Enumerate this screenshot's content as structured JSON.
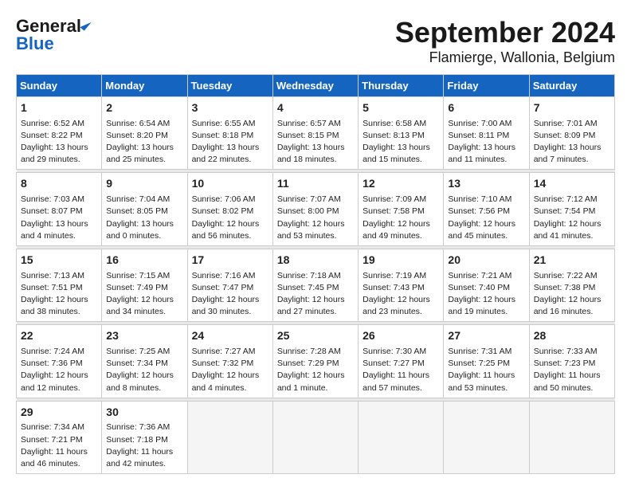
{
  "header": {
    "logo_line1": "General",
    "logo_line2": "Blue",
    "month_title": "September 2024",
    "location": "Flamierge, Wallonia, Belgium"
  },
  "weekdays": [
    "Sunday",
    "Monday",
    "Tuesday",
    "Wednesday",
    "Thursday",
    "Friday",
    "Saturday"
  ],
  "weeks": [
    [
      {
        "day": "1",
        "info": "Sunrise: 6:52 AM\nSunset: 8:22 PM\nDaylight: 13 hours\nand 29 minutes."
      },
      {
        "day": "2",
        "info": "Sunrise: 6:54 AM\nSunset: 8:20 PM\nDaylight: 13 hours\nand 25 minutes."
      },
      {
        "day": "3",
        "info": "Sunrise: 6:55 AM\nSunset: 8:18 PM\nDaylight: 13 hours\nand 22 minutes."
      },
      {
        "day": "4",
        "info": "Sunrise: 6:57 AM\nSunset: 8:15 PM\nDaylight: 13 hours\nand 18 minutes."
      },
      {
        "day": "5",
        "info": "Sunrise: 6:58 AM\nSunset: 8:13 PM\nDaylight: 13 hours\nand 15 minutes."
      },
      {
        "day": "6",
        "info": "Sunrise: 7:00 AM\nSunset: 8:11 PM\nDaylight: 13 hours\nand 11 minutes."
      },
      {
        "day": "7",
        "info": "Sunrise: 7:01 AM\nSunset: 8:09 PM\nDaylight: 13 hours\nand 7 minutes."
      }
    ],
    [
      {
        "day": "8",
        "info": "Sunrise: 7:03 AM\nSunset: 8:07 PM\nDaylight: 13 hours\nand 4 minutes."
      },
      {
        "day": "9",
        "info": "Sunrise: 7:04 AM\nSunset: 8:05 PM\nDaylight: 13 hours\nand 0 minutes."
      },
      {
        "day": "10",
        "info": "Sunrise: 7:06 AM\nSunset: 8:02 PM\nDaylight: 12 hours\nand 56 minutes."
      },
      {
        "day": "11",
        "info": "Sunrise: 7:07 AM\nSunset: 8:00 PM\nDaylight: 12 hours\nand 53 minutes."
      },
      {
        "day": "12",
        "info": "Sunrise: 7:09 AM\nSunset: 7:58 PM\nDaylight: 12 hours\nand 49 minutes."
      },
      {
        "day": "13",
        "info": "Sunrise: 7:10 AM\nSunset: 7:56 PM\nDaylight: 12 hours\nand 45 minutes."
      },
      {
        "day": "14",
        "info": "Sunrise: 7:12 AM\nSunset: 7:54 PM\nDaylight: 12 hours\nand 41 minutes."
      }
    ],
    [
      {
        "day": "15",
        "info": "Sunrise: 7:13 AM\nSunset: 7:51 PM\nDaylight: 12 hours\nand 38 minutes."
      },
      {
        "day": "16",
        "info": "Sunrise: 7:15 AM\nSunset: 7:49 PM\nDaylight: 12 hours\nand 34 minutes."
      },
      {
        "day": "17",
        "info": "Sunrise: 7:16 AM\nSunset: 7:47 PM\nDaylight: 12 hours\nand 30 minutes."
      },
      {
        "day": "18",
        "info": "Sunrise: 7:18 AM\nSunset: 7:45 PM\nDaylight: 12 hours\nand 27 minutes."
      },
      {
        "day": "19",
        "info": "Sunrise: 7:19 AM\nSunset: 7:43 PM\nDaylight: 12 hours\nand 23 minutes."
      },
      {
        "day": "20",
        "info": "Sunrise: 7:21 AM\nSunset: 7:40 PM\nDaylight: 12 hours\nand 19 minutes."
      },
      {
        "day": "21",
        "info": "Sunrise: 7:22 AM\nSunset: 7:38 PM\nDaylight: 12 hours\nand 16 minutes."
      }
    ],
    [
      {
        "day": "22",
        "info": "Sunrise: 7:24 AM\nSunset: 7:36 PM\nDaylight: 12 hours\nand 12 minutes."
      },
      {
        "day": "23",
        "info": "Sunrise: 7:25 AM\nSunset: 7:34 PM\nDaylight: 12 hours\nand 8 minutes."
      },
      {
        "day": "24",
        "info": "Sunrise: 7:27 AM\nSunset: 7:32 PM\nDaylight: 12 hours\nand 4 minutes."
      },
      {
        "day": "25",
        "info": "Sunrise: 7:28 AM\nSunset: 7:29 PM\nDaylight: 12 hours\nand 1 minute."
      },
      {
        "day": "26",
        "info": "Sunrise: 7:30 AM\nSunset: 7:27 PM\nDaylight: 11 hours\nand 57 minutes."
      },
      {
        "day": "27",
        "info": "Sunrise: 7:31 AM\nSunset: 7:25 PM\nDaylight: 11 hours\nand 53 minutes."
      },
      {
        "day": "28",
        "info": "Sunrise: 7:33 AM\nSunset: 7:23 PM\nDaylight: 11 hours\nand 50 minutes."
      }
    ],
    [
      {
        "day": "29",
        "info": "Sunrise: 7:34 AM\nSunset: 7:21 PM\nDaylight: 11 hours\nand 46 minutes."
      },
      {
        "day": "30",
        "info": "Sunrise: 7:36 AM\nSunset: 7:18 PM\nDaylight: 11 hours\nand 42 minutes."
      },
      {
        "day": "",
        "info": ""
      },
      {
        "day": "",
        "info": ""
      },
      {
        "day": "",
        "info": ""
      },
      {
        "day": "",
        "info": ""
      },
      {
        "day": "",
        "info": ""
      }
    ]
  ]
}
